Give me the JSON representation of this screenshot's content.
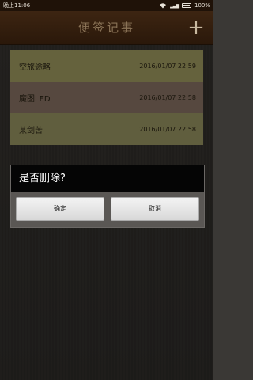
{
  "status": {
    "time": "晚上11:06",
    "battery": "100%"
  },
  "app": {
    "title": "便签记事",
    "add_glyph": "+"
  },
  "notes": [
    {
      "title": "空旅途略",
      "date": "2016/01/07 22:59"
    },
    {
      "title": "魔图LED",
      "date": "2016/01/07 22:58"
    },
    {
      "title": "某剑苦",
      "date": "2016/01/07 22:58"
    }
  ],
  "dialog": {
    "message": "是否删除?",
    "ok_label": "确定",
    "cancel_label": "取消"
  },
  "colors": {
    "appbar": "#3d2512",
    "row1": "#a39e63",
    "row2": "#8c7566",
    "row3": "#9c9864",
    "dialog_header": "#050505"
  }
}
